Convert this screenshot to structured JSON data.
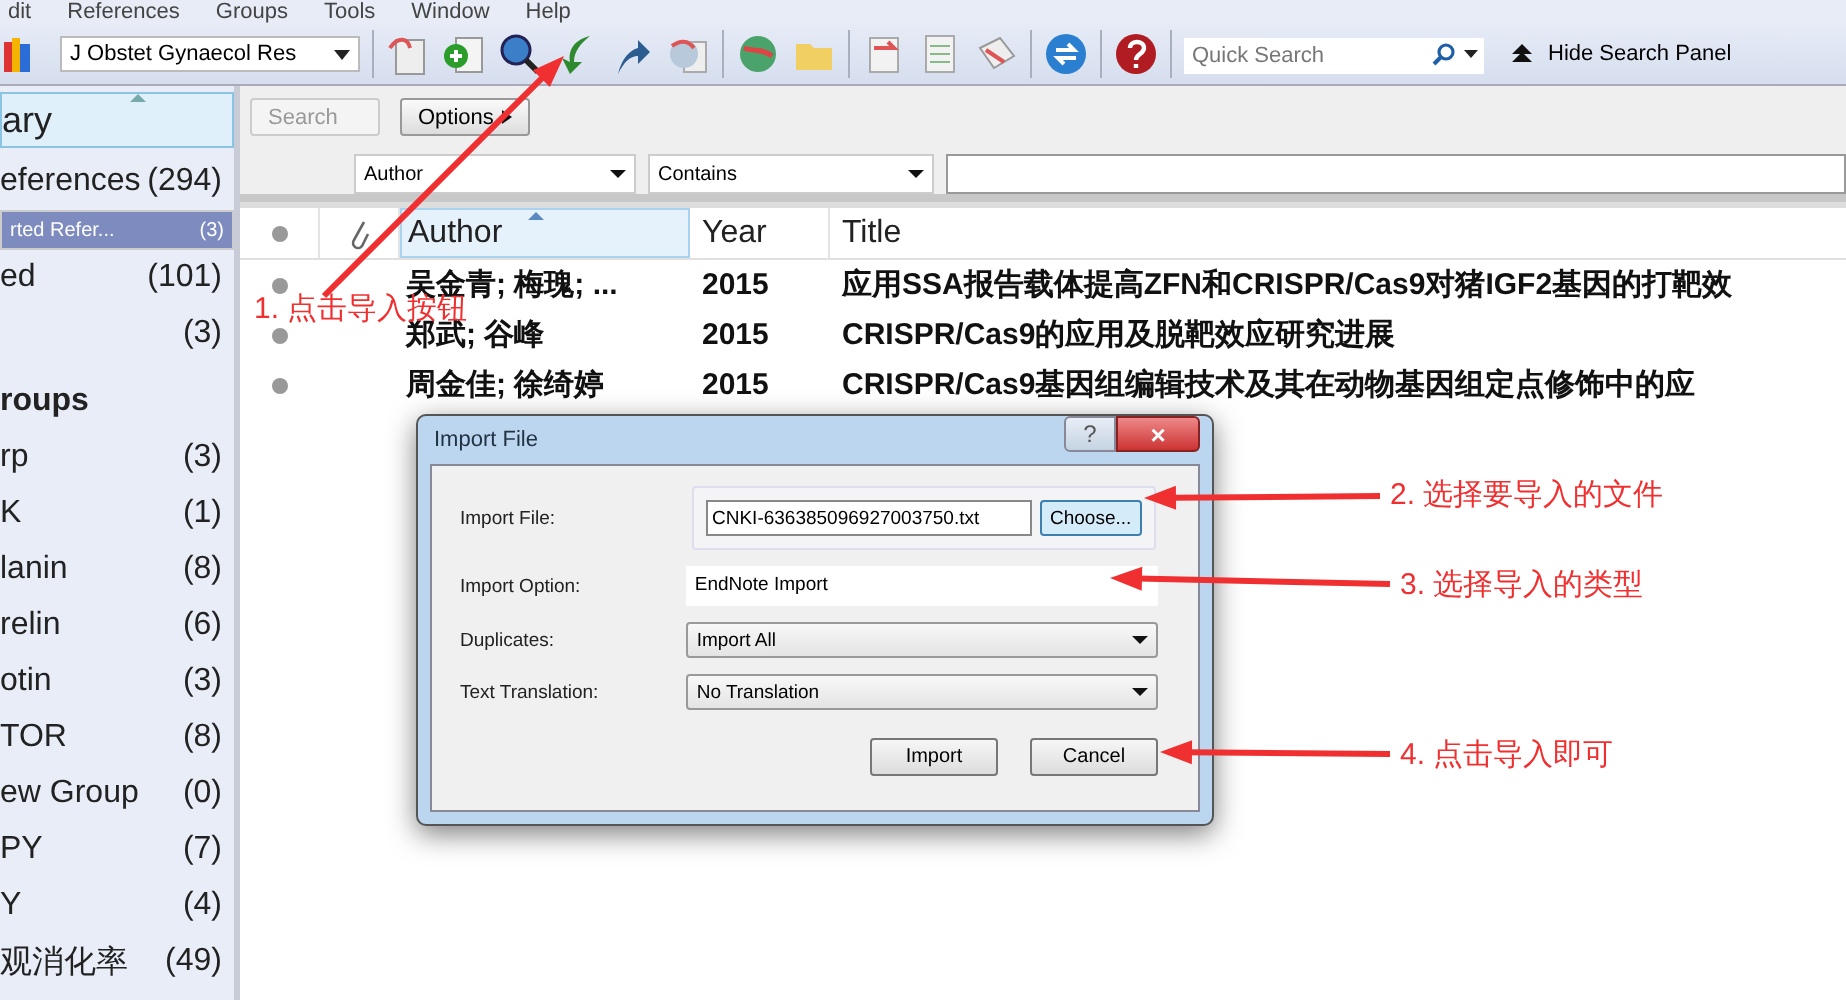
{
  "menu": [
    "dit",
    "References",
    "Groups",
    "Tools",
    "Window",
    "Help"
  ],
  "toolbar": {
    "style_select": "J Obstet Gynaecol Res",
    "quick_search": {
      "placeholder": "Quick Search"
    },
    "hide_panel": "Hide Search Panel"
  },
  "sidebar": {
    "items": [
      {
        "kind": "header",
        "label": "ary",
        "selected": false
      },
      {
        "kind": "item",
        "label": "eferences",
        "count": "(294)",
        "selected": false
      },
      {
        "kind": "item",
        "label": "rted Refer...",
        "count": "(3)",
        "selected": true
      },
      {
        "kind": "item",
        "label": "ed",
        "count": "(101)",
        "selected": false
      },
      {
        "kind": "item",
        "count": "(3)",
        "selected": false
      },
      {
        "kind": "group-heading",
        "label": "roups",
        "selected": false
      },
      {
        "kind": "item",
        "label": "rp",
        "count": "(3)",
        "selected": false
      },
      {
        "kind": "item",
        "label": "K",
        "count": "(1)",
        "selected": false
      },
      {
        "kind": "item",
        "label": "lanin",
        "count": "(8)",
        "selected": false
      },
      {
        "kind": "item",
        "label": "relin",
        "count": "(6)",
        "selected": false
      },
      {
        "kind": "item",
        "label": "otin",
        "count": "(3)",
        "selected": false
      },
      {
        "kind": "item",
        "label": "TOR",
        "count": "(8)",
        "selected": false
      },
      {
        "kind": "item",
        "label": "ew Group",
        "count": "(0)",
        "selected": false
      },
      {
        "kind": "item",
        "label": "PY",
        "count": "(7)",
        "selected": false
      },
      {
        "kind": "item",
        "label": "Y",
        "count": "(4)",
        "selected": false
      },
      {
        "kind": "item",
        "label": "观消化率",
        "count": "(49)",
        "selected": false
      }
    ]
  },
  "search_panel": {
    "search_button": {
      "label": "Search",
      "disabled": true
    },
    "options_button": "Options",
    "field_select": "Author",
    "condition_select": "Contains"
  },
  "table": {
    "columns": [
      "Author",
      "Year",
      "Title"
    ],
    "rows": [
      {
        "author": "吴金青; 梅瑰; ...",
        "year": "2015",
        "title": "应用SSA报告载体提高ZFN和CRISPR/Cas9对猪IGF2基因的打靶效",
        "unread": true
      },
      {
        "author": "郑武; 谷峰",
        "year": "2015",
        "title": "CRISPR/Cas9的应用及脱靶效应研究进展",
        "unread": true
      },
      {
        "author": "周金佳; 徐绮婷",
        "year": "2015",
        "title": "CRISPR/Cas9基因组编辑技术及其在动物基因组定点修饰中的应",
        "unread": true
      }
    ]
  },
  "dialog": {
    "title": "Import File",
    "help": "?",
    "close": "×",
    "import_file": {
      "label": "Import File:",
      "value": "CNKI-636385096927003750.txt",
      "button": "Choose..."
    },
    "import_option": {
      "label": "Import Option:",
      "value": "EndNote Import"
    },
    "duplicates": {
      "label": "Duplicates:",
      "value": "Import All"
    },
    "text_translation": {
      "label": "Text Translation:",
      "value": "No Translation"
    },
    "buttons": [
      "Import",
      "Cancel"
    ]
  },
  "annotations": [
    {
      "text": "1. 点击导入按钮"
    },
    {
      "text": "2. 选择要导入的文件"
    },
    {
      "text": "3. 选择导入的类型"
    },
    {
      "text": "4. 点击导入即可"
    }
  ]
}
